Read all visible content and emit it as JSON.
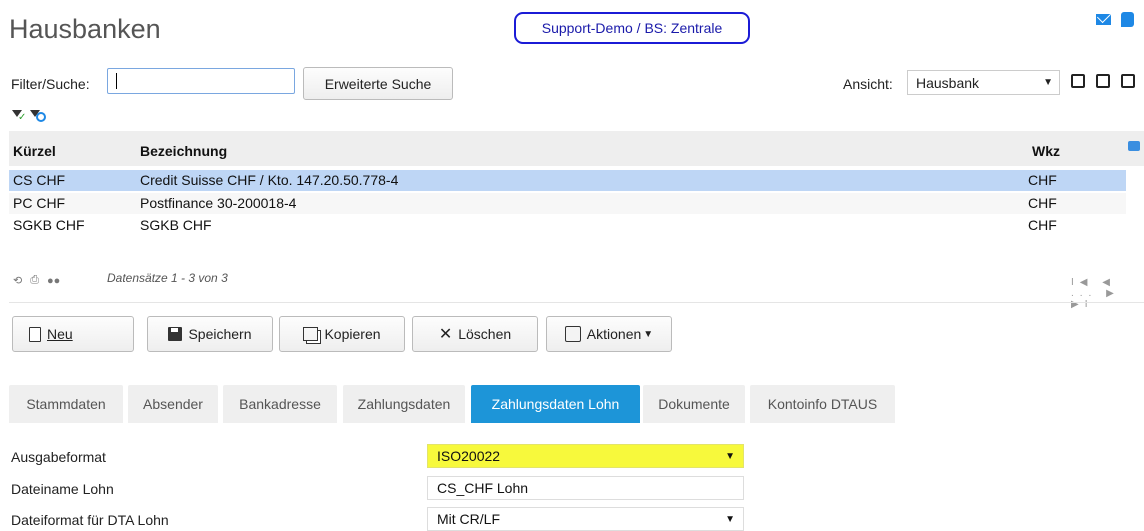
{
  "header": {
    "title": "Hausbanken",
    "context_badge": "Support-Demo / BS: Zentrale"
  },
  "filter": {
    "label": "Filter/Suche:",
    "value": "",
    "extended_search_label": "Erweiterte Suche",
    "view_label": "Ansicht:",
    "view_value": "Hausbank"
  },
  "table": {
    "columns": [
      "Kürzel",
      "Bezeichnung",
      "Wkz"
    ],
    "rows": [
      {
        "kuerzel": "CS CHF",
        "bezeichnung": "Credit Suisse CHF / Kto. 147.20.50.778-4",
        "wkz": "CHF"
      },
      {
        "kuerzel": "PC CHF",
        "bezeichnung": "Postfinance 30-200018-4",
        "wkz": "CHF"
      },
      {
        "kuerzel": "SGKB CHF",
        "bezeichnung": "SGKB CHF",
        "wkz": "CHF"
      }
    ],
    "records_text": "Datensätze 1 - 3 von 3",
    "pager_text": "I◀ ◀ ... ▶ ▶I"
  },
  "actions": {
    "new": "Neu",
    "save": "Speichern",
    "copy": "Kopieren",
    "delete": "Löschen",
    "more": "Aktionen"
  },
  "tabs": [
    "Stammdaten",
    "Absender",
    "Bankadresse",
    "Zahlungsdaten",
    "Zahlungsdaten Lohn",
    "Dokumente",
    "Kontoinfo DTAUS"
  ],
  "active_tab": "Zahlungsdaten Lohn",
  "form": {
    "ausgabeformat_label": "Ausgabeformat",
    "ausgabeformat_value": "ISO20022",
    "dateiname_label": "Dateiname Lohn",
    "dateiname_value": "CS_CHF Lohn",
    "dateiformat_label": "Dateiformat für DTA Lohn",
    "dateiformat_value": "Mit CR/LF"
  },
  "colors": {
    "accent": "#1d95d8",
    "selection": "#bed6f5",
    "highlight": "#f7f93c",
    "badge_border": "#1b1bd6"
  }
}
